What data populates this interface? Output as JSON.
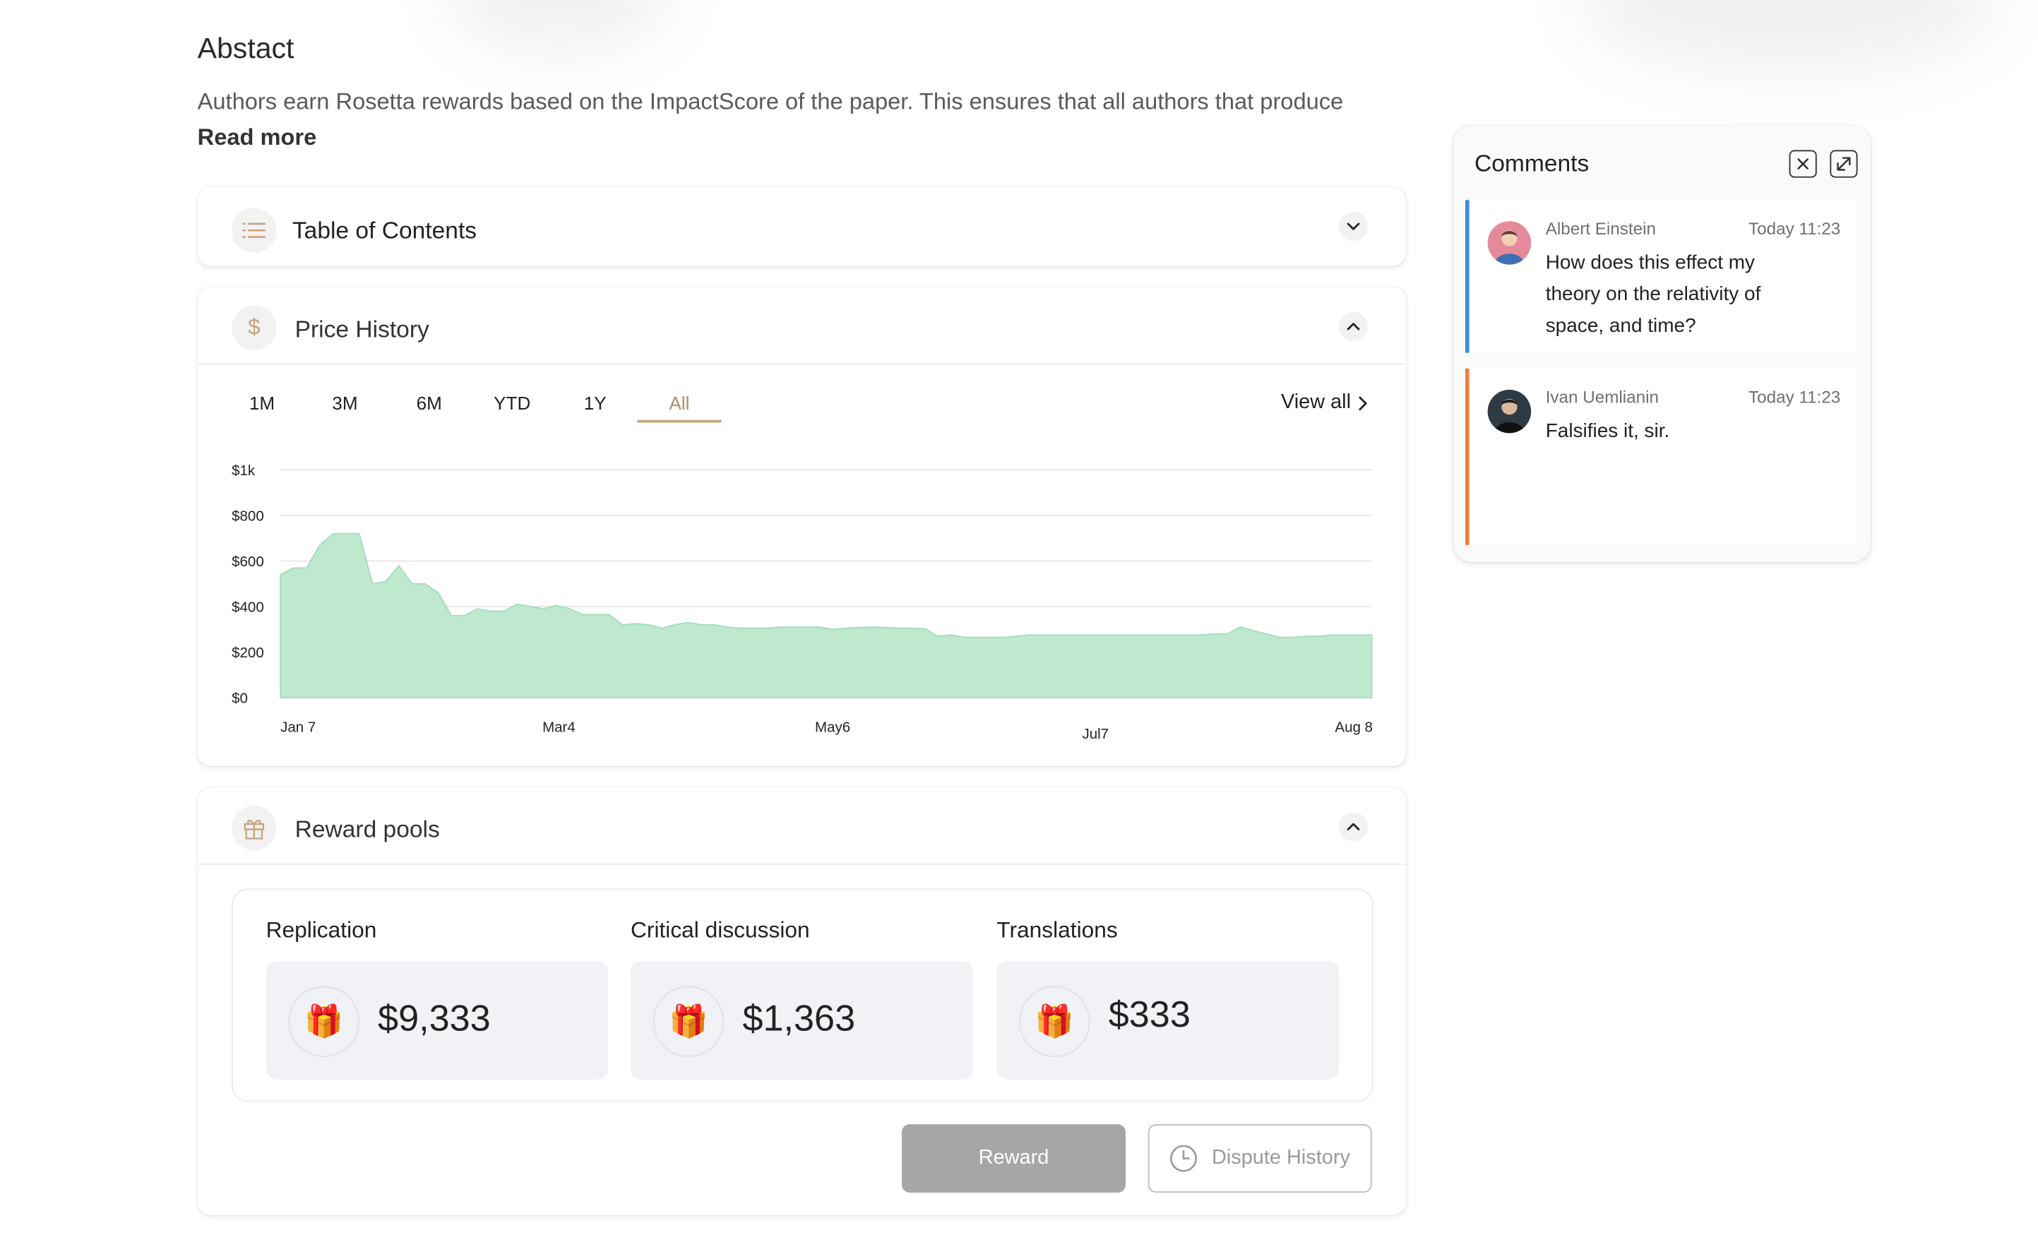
{
  "abstract": {
    "title": "Abstact",
    "text": "Authors earn Rosetta rewards based on the ImpactScore of the paper. This ensures that all authors that produce",
    "read_more": "Read more"
  },
  "toc": {
    "title": "Table of Contents"
  },
  "price_history": {
    "title": "Price History",
    "ranges": [
      "1M",
      "3M",
      "6M",
      "YTD",
      "1Y",
      "All"
    ],
    "active_range": "All",
    "view_all": "View all"
  },
  "chart_data": {
    "type": "area",
    "x_ticks": [
      "Jan 7",
      "Mar4",
      "May6",
      "Jul7",
      "Aug 8"
    ],
    "y_ticks": [
      "$0",
      "$200",
      "$400",
      "$600",
      "$800",
      "$1k"
    ],
    "ylim": [
      0,
      1000
    ],
    "grid": true,
    "color": "#bfe9cf",
    "values": [
      540,
      570,
      570,
      670,
      720,
      720,
      720,
      500,
      510,
      580,
      500,
      500,
      460,
      360,
      360,
      390,
      380,
      380,
      410,
      400,
      390,
      405,
      390,
      365,
      365,
      365,
      320,
      325,
      320,
      305,
      320,
      330,
      320,
      320,
      310,
      305,
      305,
      305,
      310,
      310,
      310,
      310,
      300,
      305,
      308,
      310,
      308,
      305,
      305,
      303,
      270,
      275,
      265,
      265,
      265,
      265,
      270,
      275,
      275,
      275,
      275,
      275,
      275,
      275,
      275,
      275,
      275,
      275,
      275,
      275,
      275,
      280,
      280,
      310,
      295,
      280,
      265,
      265,
      270,
      270,
      275,
      275,
      275,
      275
    ]
  },
  "reward_pools": {
    "title": "Reward pools",
    "pools": [
      {
        "label": "Replication",
        "amount": "$9,333"
      },
      {
        "label": "Critical discussion",
        "amount": "$1,363"
      },
      {
        "label": "Translations",
        "amount": "$333"
      }
    ],
    "reward_button": "Reward",
    "dispute_button": "Dispute History"
  },
  "comments": {
    "title": "Comments",
    "items": [
      {
        "author": "Albert Einstein",
        "time": "Today 11:23",
        "text": "How does this effect my theory on the relativity of space, and time?",
        "bar_color": "#3b8be0",
        "avatar_bg": "#e58a9a"
      },
      {
        "author": "Ivan Uemlianin",
        "time": "Today 11:23",
        "text": "Falsifies it, sir.",
        "bar_color": "#f07c3a",
        "avatar_bg": "#2f3b44"
      }
    ]
  },
  "colors": {
    "accent": "#c9a27b",
    "chart_fill": "#bfe9cf",
    "chart_stroke": "#a4dcb9"
  }
}
